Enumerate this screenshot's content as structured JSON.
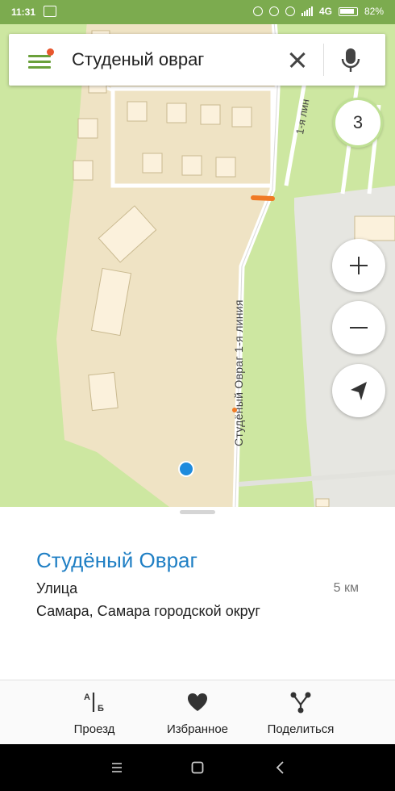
{
  "status_bar": {
    "time": "11:31",
    "network": "4G",
    "battery": "82%"
  },
  "search": {
    "query": "Студеный овраг"
  },
  "map": {
    "road_label": "Студёный Овраг 1-я линия",
    "side_road_label": "1-я лин",
    "result_count": "3"
  },
  "place": {
    "title": "Студёный Овраг",
    "type": "Улица",
    "distance": "5 км",
    "address": "Самара, Самара городской округ"
  },
  "actions": [
    {
      "label": "Проезд",
      "icon": "route-icon"
    },
    {
      "label": "Избранное",
      "icon": "heart-icon"
    },
    {
      "label": "Поделиться",
      "icon": "share-icon"
    }
  ],
  "colors": {
    "accent_green": "#6aa03a",
    "link_blue": "#1f7fc4",
    "map_green": "#cde7a1",
    "map_area": "#efe3c4"
  }
}
